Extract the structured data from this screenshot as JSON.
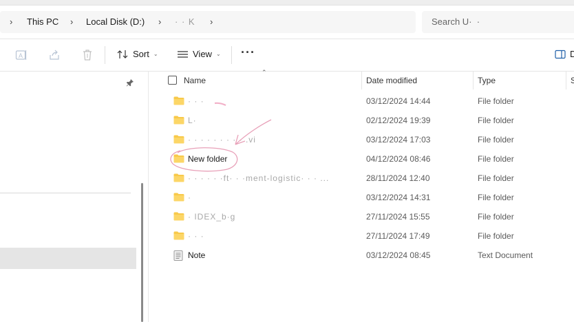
{
  "breadcrumb": {
    "items": [
      {
        "label": "This PC",
        "obscured": false
      },
      {
        "label": "Local Disk (D:)",
        "obscured": false
      },
      {
        "label": "· ·  K",
        "obscured": true
      }
    ]
  },
  "search": {
    "placeholder": "Search U·  ·"
  },
  "toolbar": {
    "sort_label": "Sort",
    "view_label": "View",
    "more_label": "···",
    "details_label": "D"
  },
  "columns": {
    "name": "Name",
    "date_modified": "Date modified",
    "type": "Type",
    "size": "S"
  },
  "files": [
    {
      "name": "·  ·  ·",
      "date": "03/12/2024 14:44",
      "type": "File folder",
      "icon": "folder-icon",
      "obscured": true
    },
    {
      "name": "L·",
      "date": "02/12/2024 19:39",
      "type": "File folder",
      "icon": "folder-icon",
      "obscured": true
    },
    {
      "name": "·  ·  ·  ·  ·  ·  ·  ·  ·  .vi",
      "date": "03/12/2024 17:03",
      "type": "File folder",
      "icon": "folder-icon",
      "obscured": true
    },
    {
      "name": "New folder",
      "date": "04/12/2024 08:46",
      "type": "File folder",
      "icon": "folder-icon",
      "obscured": false
    },
    {
      "name": "·  ·  ·  ·  ·  ·ft·  ·  ·ment-logistic·  ·  ·  ...",
      "date": "28/11/2024 12:40",
      "type": "File folder",
      "icon": "folder-icon",
      "obscured": true
    },
    {
      "name": "·",
      "date": "03/12/2024 14:31",
      "type": "File folder",
      "icon": "folder-icon",
      "obscured": true
    },
    {
      "name": "·  IDEX_b·g",
      "date": "27/11/2024 15:55",
      "type": "File folder",
      "icon": "folder-icon",
      "obscured": true
    },
    {
      "name": "·  ·  ·",
      "date": "27/11/2024 17:49",
      "type": "File folder",
      "icon": "folder-icon",
      "obscured": true
    },
    {
      "name": "Note",
      "date": "03/12/2024 08:45",
      "type": "Text Document",
      "icon": "text-document-icon",
      "obscured": false
    }
  ],
  "colors": {
    "folder": "#f8c94a",
    "annotation": "#e8a0b8",
    "selected_nav": "#e5e5e5"
  }
}
